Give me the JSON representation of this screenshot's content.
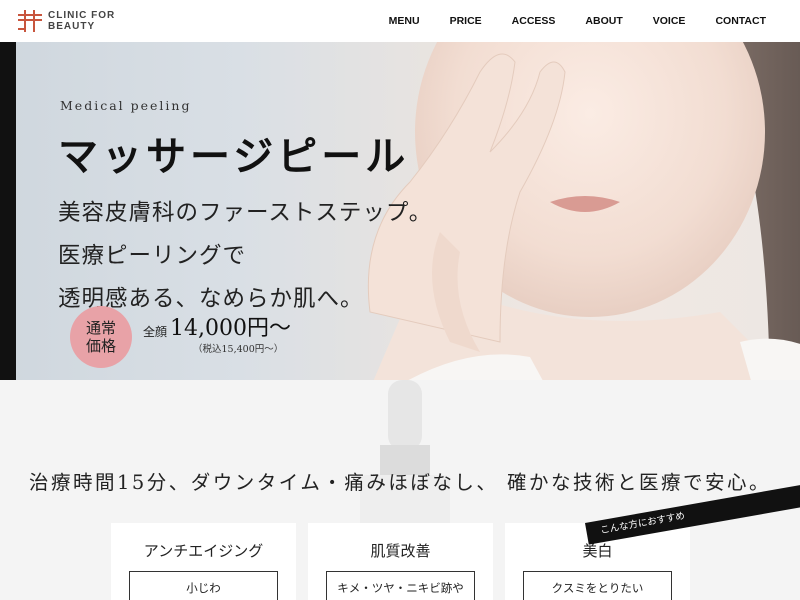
{
  "header": {
    "logo_line1": "CLINIC FOR",
    "logo_line2": "BEAUTY",
    "nav": [
      "MENU",
      "PRICE",
      "ACCESS",
      "ABOUT",
      "VOICE",
      "CONTACT"
    ]
  },
  "hero": {
    "subtitle": "Medical peeling",
    "title": "マッサージピール",
    "copy": [
      "美容皮膚科のファーストステップ。",
      "医療ピーリングで",
      "透明感ある、なめらか肌へ。"
    ],
    "badge_line1": "通常",
    "badge_line2": "価格",
    "price_prefix": "全顔",
    "price": "14,000円〜",
    "price_tax": "（税込15,400円〜）"
  },
  "lower": {
    "tagline": "治療時間15分、ダウンタイム・痛みほぼなし、 確かな技術と医療で安心。",
    "ribbon": "こんな方におすすめ",
    "cards": [
      {
        "title": "アンチエイジング",
        "item": "小じわ"
      },
      {
        "title": "肌質改善",
        "item": "キメ・ツヤ・ニキビ跡や"
      },
      {
        "title": "美白",
        "item": "クスミをとりたい"
      }
    ]
  },
  "colors": {
    "accent": "#c8553d",
    "badge": "#e8a2a7",
    "hero_bar": "#111111"
  }
}
